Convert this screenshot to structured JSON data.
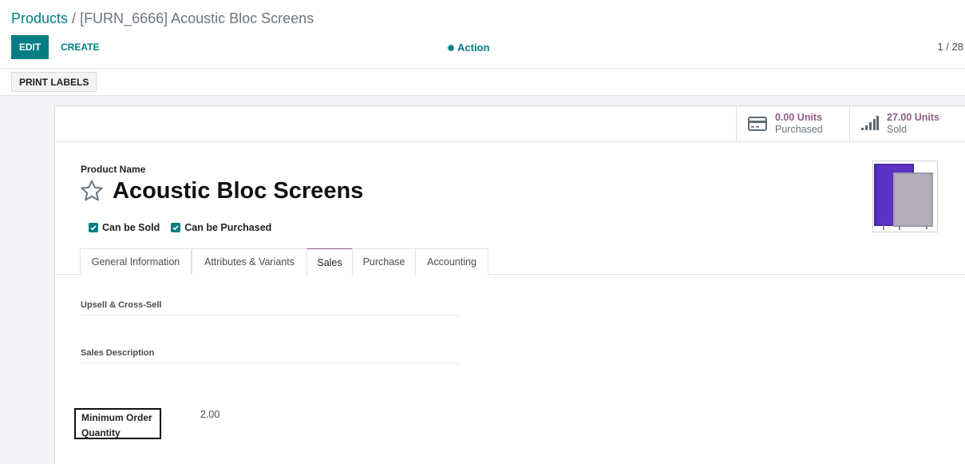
{
  "breadcrumb": {
    "parent": "Products",
    "separator": "/",
    "current": "[FURN_6666] Acoustic Bloc Screens"
  },
  "toolbar": {
    "edit_label": "EDIT",
    "create_label": "CREATE",
    "action_label": "Action",
    "action_icon": "gear-icon",
    "pager": "1 / 28"
  },
  "statusbar": {
    "print_labels": "PRINT LABELS"
  },
  "stats": {
    "purchased": {
      "value": "0.00 Units",
      "label": "Purchased",
      "icon": "credit-card-icon"
    },
    "sold": {
      "value": "27.00 Units",
      "label": "Sold",
      "icon": "signal-bars-icon"
    }
  },
  "product": {
    "name_label": "Product Name",
    "name": "Acoustic Bloc Screens",
    "can_be_sold": "Can be Sold",
    "can_be_purchased": "Can be Purchased"
  },
  "tabs": [
    {
      "label": "General Information",
      "active": false
    },
    {
      "label": "Attributes & Variants",
      "active": false
    },
    {
      "label": "Sales",
      "active": true
    },
    {
      "label": "Purchase",
      "active": false
    },
    {
      "label": "Accounting",
      "active": false
    }
  ],
  "sales": {
    "upsell_label": "Upsell & Cross-Sell",
    "description_label": "Sales Description",
    "min_order_label": "Minimum Order Quantity",
    "min_order_value": "2.00"
  },
  "colors": {
    "primary": "#017e84",
    "stat_value": "#8f5c85"
  }
}
